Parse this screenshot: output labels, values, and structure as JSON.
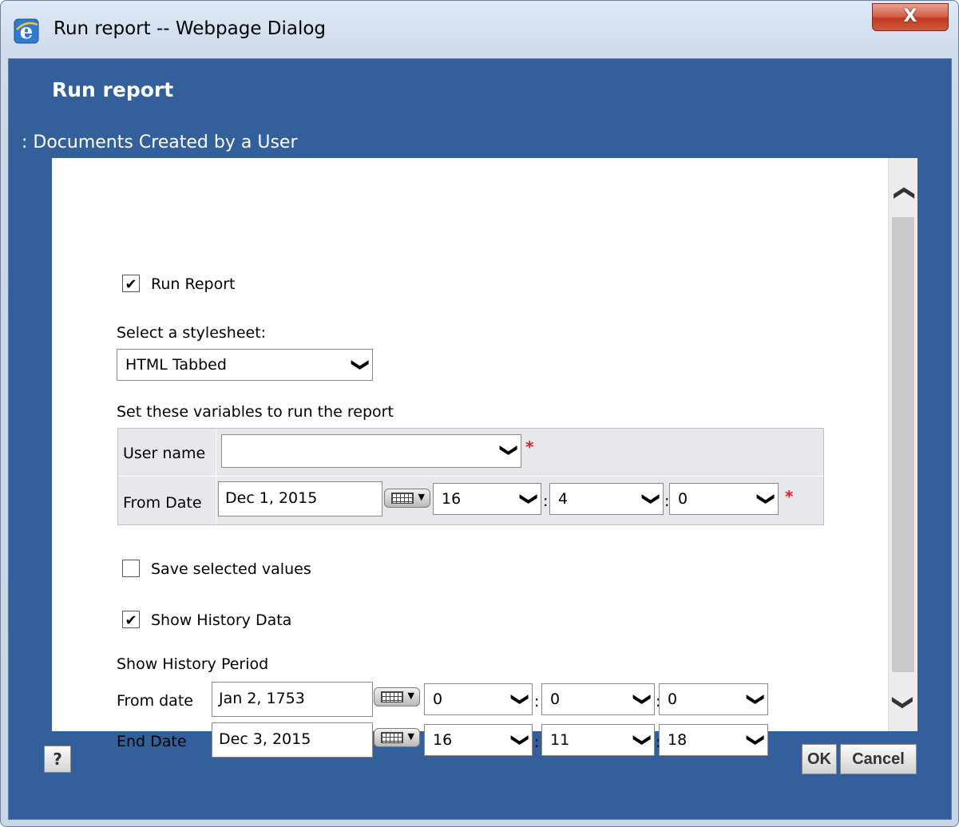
{
  "window": {
    "title": "Run report -- Webpage Dialog",
    "close_label": "X"
  },
  "dialog": {
    "heading": "Run report",
    "subtitle": ": Documents Created by a User"
  },
  "form": {
    "run_report_label": "Run Report",
    "run_report_checked": true,
    "stylesheet_label": "Select a stylesheet:",
    "stylesheet_value": "HTML Tabbed",
    "variables_heading": "Set these variables to run the report",
    "variables": {
      "user_name_label": "User name",
      "user_name_value": "",
      "from_date_label": "From Date",
      "from_date_value": "Dec 1, 2015",
      "from_hour": "16",
      "from_minute": "4",
      "from_second": "0",
      "required_mark": "*"
    },
    "save_values_label": "Save selected values",
    "save_values_checked": false,
    "show_history_label": "Show History Data",
    "show_history_checked": true,
    "history_period_label": "Show History Period",
    "history_from": {
      "label": "From date",
      "date": "Jan 2, 1753",
      "hour": "0",
      "minute": "0",
      "second": "0"
    },
    "history_end": {
      "label": "End Date",
      "date": "Dec 3, 2015",
      "hour": "16",
      "minute": "11",
      "second": "18"
    }
  },
  "footer": {
    "help_label": "?",
    "ok_label": "OK",
    "cancel_label": "Cancel"
  },
  "glyphs": {
    "check": "✔",
    "chevron": "❯",
    "colon": ":"
  }
}
